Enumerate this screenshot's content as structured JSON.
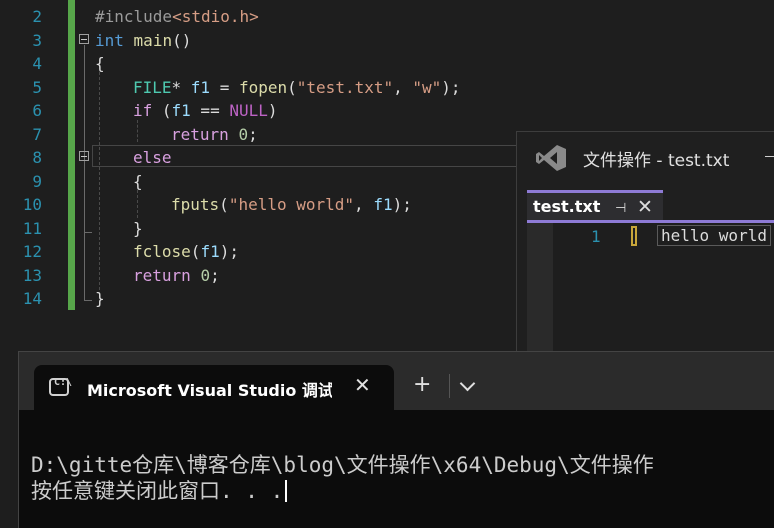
{
  "editor": {
    "line_numbers": [
      "2",
      "3",
      "4",
      "5",
      "6",
      "7",
      "8",
      "9",
      "10",
      "11",
      "12",
      "13",
      "14"
    ],
    "code": {
      "l2_pre": "#include",
      "l2_header": "<stdio.h>",
      "l3_type": "int",
      "l3_fn": "main",
      "l3_rest": "()",
      "l4": "{",
      "l5_type": "FILE",
      "l5_star": "* ",
      "l5_var": "f1",
      "l5_eq": " = ",
      "l5_fn": "fopen",
      "l5_open": "(",
      "l5_str1": "\"test.txt\"",
      "l5_comma": ", ",
      "l5_str2": "\"w\"",
      "l5_close": ");",
      "l6_kw": "if",
      "l6_open": " (",
      "l6_var": "f1",
      "l6_op": " == ",
      "l6_mac": "NULL",
      "l6_close": ")",
      "l7_kw": "return",
      "l7_num": "0",
      "l7_semi": ";",
      "l8_kw": "else",
      "l9": "{",
      "l10_fn": "fputs",
      "l10_open": "(",
      "l10_str": "\"hello world\"",
      "l10_comma": ", ",
      "l10_var": "f1",
      "l10_close": ");",
      "l11": "}",
      "l12_fn": "fclose",
      "l12_open": "(",
      "l12_var": "f1",
      "l12_close": ");",
      "l13_kw": "return",
      "l13_num": "0",
      "l13_semi": ";",
      "l14": "}"
    }
  },
  "secondary_window": {
    "title": "文件操作 - test.txt",
    "tab_label": "test.txt",
    "pin_icon": "⊣",
    "close_icon": "✕",
    "line_number": "1",
    "content": "hello world"
  },
  "terminal": {
    "tab_title": "Microsoft Visual Studio 调试控制台",
    "tab_icon": "C:\\",
    "close_icon": "✕",
    "new_tab_icon": "+",
    "output_line1": "D:\\gitte仓库\\博客仓库\\blog\\文件操作\\x64\\Debug\\文件操作",
    "output_line2": "按任意键关闭此窗口. . ."
  },
  "colors": {
    "editor_bg": "#1e1e1e",
    "change_bar": "#57a64a",
    "line_number": "#2b91af",
    "tab_accent": "#8e7bd6",
    "terminal_bg": "#0c0c0c"
  }
}
